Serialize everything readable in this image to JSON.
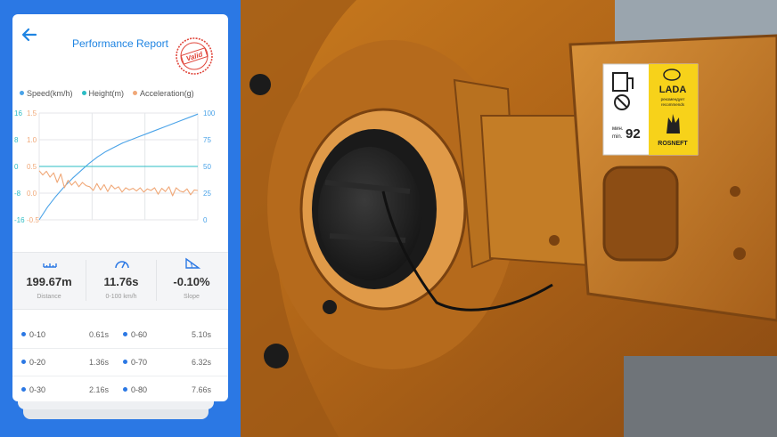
{
  "header": {
    "title": "Performance Report",
    "stamp_text": "Valid"
  },
  "legend": [
    {
      "label": "Speed(km/h)",
      "color": "#4aa3e8"
    },
    {
      "label": "Height(m)",
      "color": "#2bbcc4"
    },
    {
      "label": "Acceleration(g)",
      "color": "#f0a878"
    }
  ],
  "chart_data": {
    "type": "line",
    "axes": {
      "height_ticks": [
        "16",
        "8",
        "0",
        "-8",
        "-16"
      ],
      "acceleration_ticks": [
        "1.5",
        "1.0",
        "0.5",
        "0.0",
        "-0.5"
      ],
      "speed_ticks": [
        "100",
        "75",
        "50",
        "25",
        "0"
      ]
    },
    "series": [
      {
        "name": "Speed(km/h)",
        "color": "#4aa3e8",
        "axis": "right",
        "ylim": [
          0,
          100
        ],
        "values": [
          0,
          12,
          22,
          31,
          39,
          46,
          53,
          59,
          64,
          68,
          72,
          75,
          78,
          81,
          84,
          87,
          90,
          93,
          96,
          99
        ]
      },
      {
        "name": "Height(m)",
        "color": "#2bbcc4",
        "axis": "left",
        "ylim": [
          -16,
          16
        ],
        "values": [
          0,
          0,
          0,
          0,
          0,
          0,
          0,
          0,
          0,
          0,
          0,
          0,
          0,
          0,
          0,
          0,
          0,
          0,
          0,
          0
        ]
      },
      {
        "name": "Acceleration(g)",
        "color": "#f0a878",
        "axis": "left2",
        "ylim": [
          -0.5,
          1.5
        ],
        "values": [
          0.42,
          0.34,
          0.41,
          0.3,
          0.38,
          0.2,
          0.36,
          0.1,
          0.24,
          0.15,
          0.22,
          0.12,
          0.2,
          0.14,
          0.12,
          0.05,
          0.18,
          0.06,
          0.16,
          0.03,
          0.15,
          0.08,
          0.12,
          0.02,
          0.1,
          0.06,
          0.09,
          0.04,
          0.1,
          0.02,
          0.08,
          0.05,
          0.1,
          -0.02,
          0.09,
          0.03,
          0.12,
          -0.05,
          0.1,
          0.04,
          0.02,
          0.08,
          -0.03,
          0.06,
          0.05
        ]
      }
    ]
  },
  "stats": [
    {
      "value": "199.67m",
      "label": "Distance",
      "icon": "distance-ruler-icon"
    },
    {
      "value": "11.76s",
      "label": "0-100 km/h",
      "icon": "speedometer-icon"
    },
    {
      "value": "-0.10%",
      "label": "Slope",
      "icon": "slope-icon"
    }
  ],
  "times": [
    {
      "left_label": "0-10",
      "left_value": "0.61s",
      "right_label": "0-60",
      "right_value": "5.10s"
    },
    {
      "left_label": "0-20",
      "left_value": "1.36s",
      "right_label": "0-70",
      "right_value": "6.32s"
    },
    {
      "left_label": "0-30",
      "left_value": "2.16s",
      "right_label": "0-80",
      "right_value": "7.66s"
    }
  ],
  "photo": {
    "sticker_brand": "LADA",
    "sticker_recommend": "рекомендует",
    "sticker_recommend2": "recommends",
    "sticker_fuel_min": "мин.",
    "sticker_fuel_min2": "min.",
    "sticker_octane": "92",
    "sticker_sponsor": "ROSNEFT"
  }
}
